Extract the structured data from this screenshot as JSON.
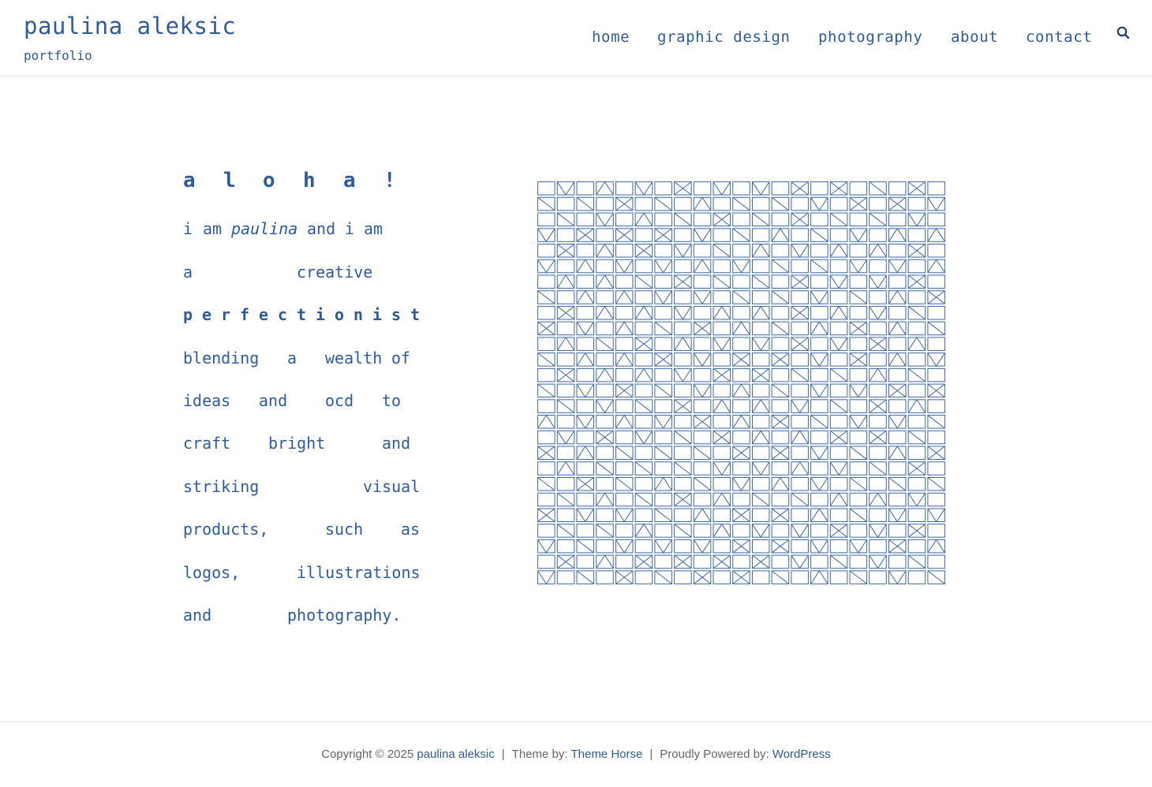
{
  "site": {
    "title": "paulina aleksic",
    "tagline": "portfolio"
  },
  "nav": {
    "items": [
      "home",
      "graphic design",
      "photography",
      "about",
      "contact"
    ],
    "search_icon": "search-icon"
  },
  "intro": {
    "heading": [
      "a",
      "l",
      "o",
      "h",
      "a",
      "!"
    ],
    "lines": [
      [
        "i",
        "am",
        "paulina",
        "and",
        "i",
        "am"
      ],
      [
        "a",
        "creative"
      ],
      [
        "p",
        "e",
        "r",
        "f",
        "e",
        "c",
        "t",
        "i",
        "o",
        "n",
        "i",
        "s",
        "t"
      ],
      [
        "blending",
        "a",
        "wealth",
        "of"
      ],
      [
        "ideas",
        "and",
        "ocd",
        "to"
      ],
      [
        "craft",
        "bright",
        "and"
      ],
      [
        "striking",
        "visual"
      ],
      [
        "products,",
        "such",
        "as"
      ],
      [
        "logos,",
        "illustrations"
      ],
      [
        "and",
        "photography."
      ]
    ]
  },
  "pattern": {
    "icon": "geometric-pattern",
    "stroke_color": "#3d67a3"
  },
  "footer": {
    "copyright": "Copyright © 2025",
    "owner_link": "paulina aleksic",
    "theme_prefix": "Theme by:",
    "theme_link": "Theme Horse",
    "powered_prefix": "Proudly Powered by:",
    "powered_link": "WordPress"
  },
  "colors": {
    "accent": "#2f5c96",
    "footer_text": "#666666",
    "divider": "#e6e6e6"
  }
}
